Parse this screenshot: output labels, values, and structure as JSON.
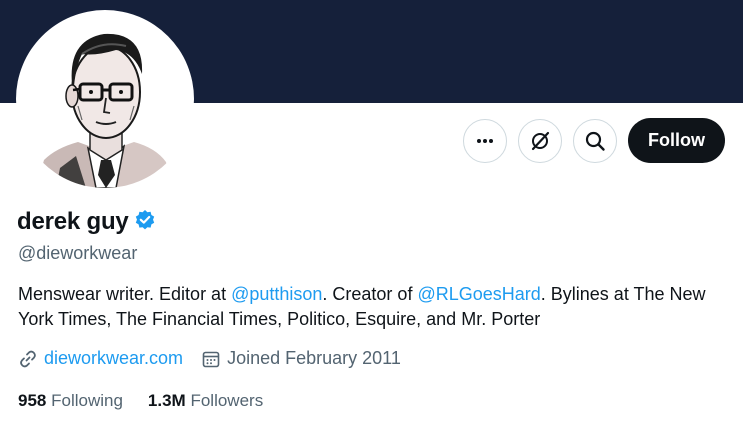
{
  "profile": {
    "name": "derek guy",
    "handle": "@dieworkwear",
    "bio": {
      "part1": "Menswear writer. Editor at ",
      "mention1": "@putthison",
      "part2": ". Creator of ",
      "mention2": "@RLGoesHard",
      "part3": ". Bylines at The New York Times, The Financial Times, Politico, Esquire, and Mr. Porter"
    },
    "website": "dieworkwear.com",
    "joined": "Joined February 2011",
    "following_count": "958",
    "following_label": "Following",
    "followers_count": "1.3M",
    "followers_label": "Followers"
  },
  "actions": {
    "more_icon": "more-icon",
    "grok_icon": "slash-circle-icon",
    "search_icon": "search-icon",
    "follow_label": "Follow"
  },
  "colors": {
    "banner": "#15203a",
    "link": "#1d9bf0",
    "verified": "#1d9bf0",
    "follow_bg": "#0f1419",
    "secondary_text": "#536471"
  }
}
